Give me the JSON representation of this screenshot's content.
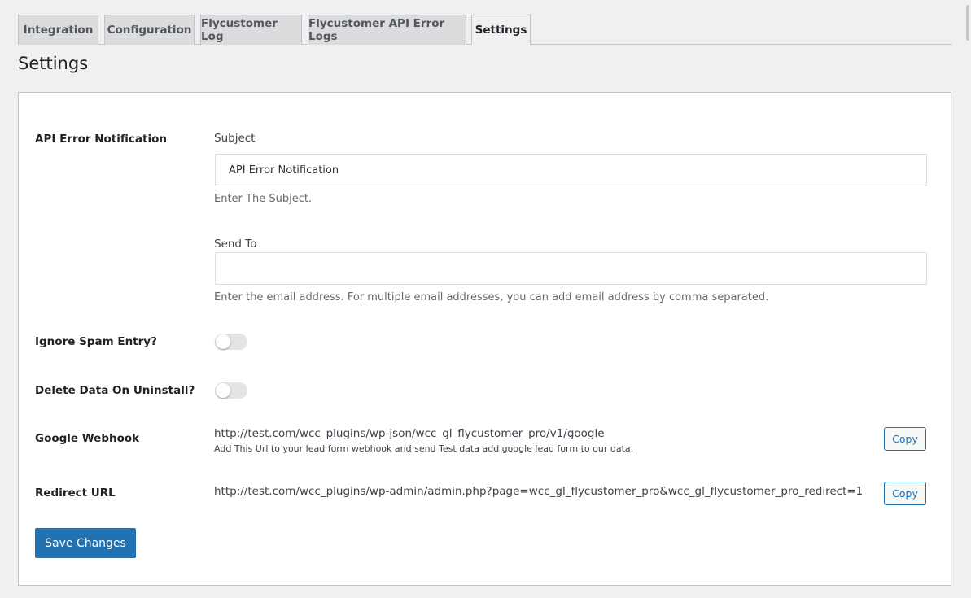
{
  "tabs": [
    {
      "label": "Integration"
    },
    {
      "label": "Configuration"
    },
    {
      "label": "Flycustomer Log"
    },
    {
      "label": "Flycustomer API Error Logs"
    },
    {
      "label": "Settings"
    }
  ],
  "page_title": "Settings",
  "api_error_notification": {
    "label": "API Error Notification",
    "subject_label": "Subject",
    "subject_value": "API Error Notification",
    "subject_help": "Enter The Subject.",
    "send_to_label": "Send To",
    "send_to_value": "",
    "send_to_help": "Enter the email address. For multiple email addresses, you can add email address by comma separated."
  },
  "ignore_spam": {
    "label": "Ignore Spam Entry?",
    "enabled": false
  },
  "delete_data": {
    "label": "Delete Data On Uninstall?",
    "enabled": false
  },
  "google_webhook": {
    "label": "Google Webhook",
    "url": "http://test.com/wcc_plugins/wp-json/wcc_gl_flycustomer_pro/v1/google",
    "note": "Add This Url to your lead form webhook and send Test data add google lead form to our data.",
    "copy_label": "Copy"
  },
  "redirect_url": {
    "label": "Redirect URL",
    "url": "http://test.com/wcc_plugins/wp-admin/admin.php?page=wcc_gl_flycustomer_pro&wcc_gl_flycustomer_pro_redirect=1",
    "copy_label": "Copy"
  },
  "save_label": "Save Changes",
  "colors": {
    "primary": "#2271b1",
    "background": "#f0f0f1",
    "card": "#ffffff"
  }
}
